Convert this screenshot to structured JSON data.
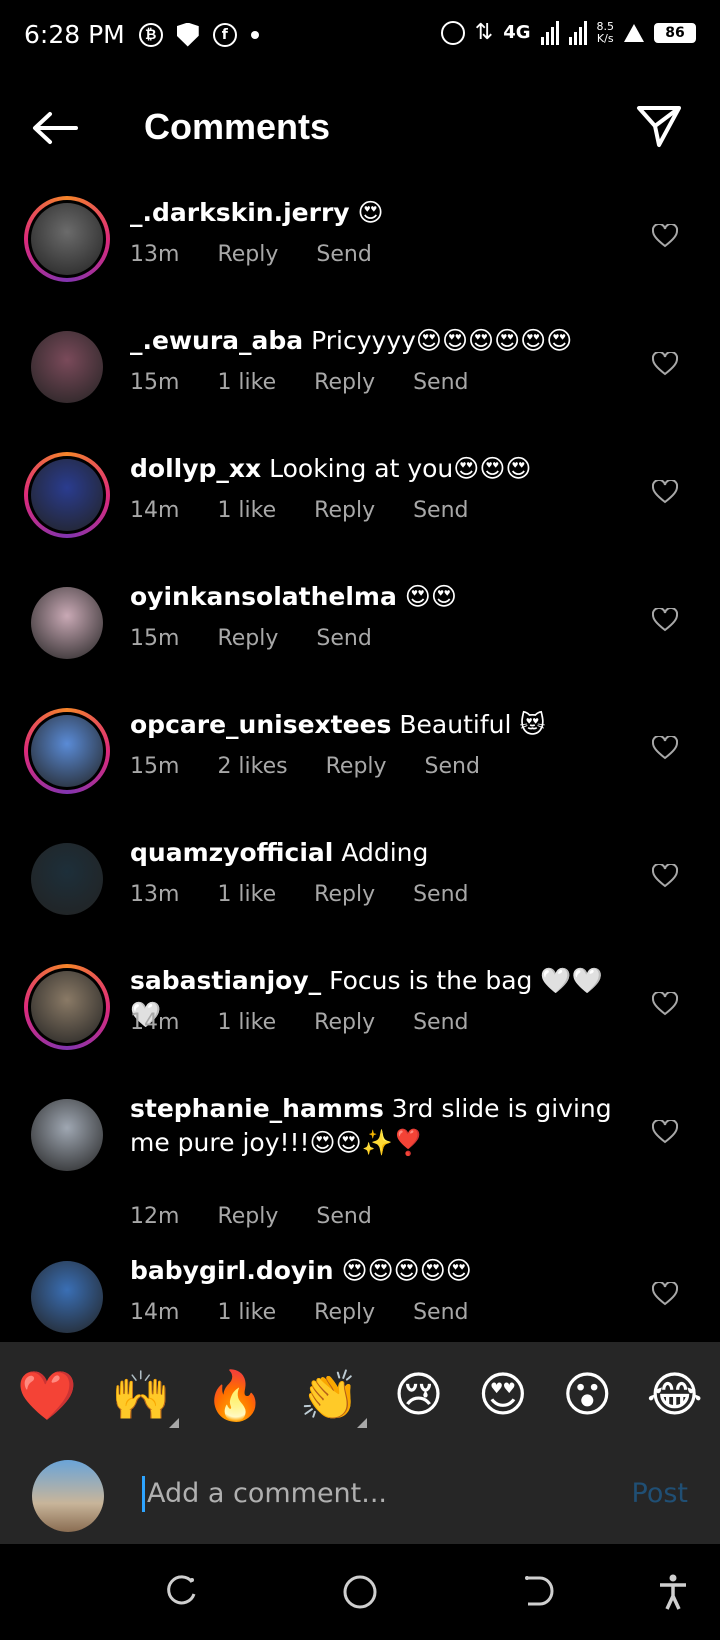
{
  "status_bar": {
    "time": "6:28 PM",
    "network": "4G",
    "speed_value": "8.5",
    "speed_unit": "K/s",
    "battery": "86"
  },
  "header": {
    "title": "Comments"
  },
  "comments": [
    {
      "username": "_.darkskin.jerry",
      "text": "😍",
      "time": "13m",
      "likes": "",
      "story": true,
      "avatar_color": "#6b6b6b"
    },
    {
      "username": "_.ewura_aba",
      "text": "Pricyyyy😍😍😍😍😍😍",
      "time": "15m",
      "likes": "1 like",
      "story": false,
      "avatar_color": "#7a4a5a"
    },
    {
      "username": "dollyp_xx",
      "text": "Looking at you😍😍😍",
      "time": "14m",
      "likes": "1 like",
      "story": true,
      "avatar_color": "#2a3c8f"
    },
    {
      "username": "oyinkansolathelma",
      "text": "😍😍",
      "time": "15m",
      "likes": "",
      "story": false,
      "avatar_color": "#c9a9b5"
    },
    {
      "username": "opcare_unisextees",
      "text": "Beautiful 😻",
      "time": "15m",
      "likes": "2 likes",
      "story": true,
      "avatar_color": "#5a8bd6"
    },
    {
      "username": "quamzyofficial",
      "text": "Adding",
      "time": "13m",
      "likes": "1 like",
      "story": false,
      "avatar_color": "#1d2f3a"
    },
    {
      "username": "sabastianjoy_",
      "text": "Focus is the bag 🤍🤍🤍",
      "time": "14m",
      "likes": "1 like",
      "story": true,
      "avatar_color": "#8a7a66"
    },
    {
      "username": "stephanie_hamms",
      "text": "3rd slide is giving me pure joy!!!😍😍✨❣️",
      "time": "12m",
      "likes": "",
      "story": false,
      "avatar_color": "#9fa7b2"
    },
    {
      "username": "babygirl.doyin",
      "text": "😍😍😍😍😍",
      "time": "14m",
      "likes": "1 like",
      "story": false,
      "avatar_color": "#3a6fb5"
    }
  ],
  "actions": {
    "reply": "Reply",
    "send": "Send"
  },
  "emoji_bar": [
    "❤️",
    "🙌",
    "🔥",
    "👏",
    "😢",
    "😍",
    "😮",
    "😂"
  ],
  "compose": {
    "placeholder": "Add a comment...",
    "post_label": "Post"
  }
}
